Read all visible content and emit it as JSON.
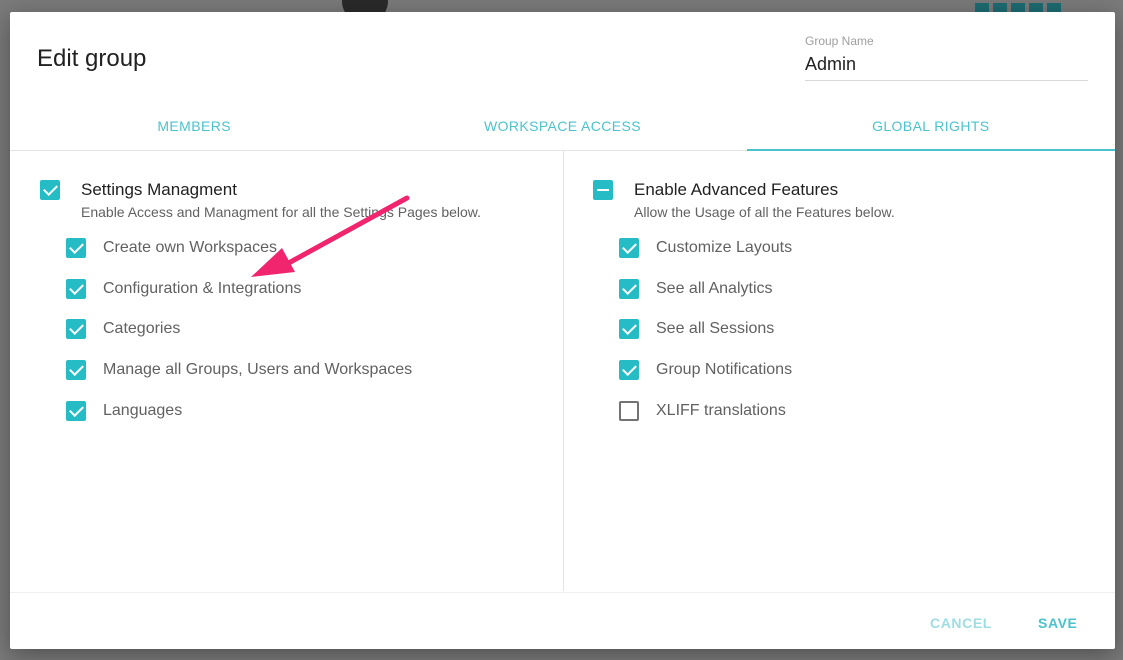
{
  "dialog": {
    "title": "Edit group",
    "group_name_label": "Group Name",
    "group_name_value": "Admin"
  },
  "tabs": [
    {
      "label": "MEMBERS",
      "active": false
    },
    {
      "label": "WORKSPACE ACCESS",
      "active": false
    },
    {
      "label": "GLOBAL RIGHTS",
      "active": true
    }
  ],
  "left_section": {
    "title": "Settings Managment",
    "description": "Enable Access and Managment for all the Settings Pages below.",
    "state": "checked",
    "items": [
      {
        "label": "Create own Workspaces",
        "checked": true
      },
      {
        "label": "Configuration & Integrations",
        "checked": true
      },
      {
        "label": "Categories",
        "checked": true
      },
      {
        "label": "Manage all Groups, Users and Workspaces",
        "checked": true
      },
      {
        "label": "Languages",
        "checked": true
      }
    ]
  },
  "right_section": {
    "title": "Enable Advanced Features",
    "description": "Allow the Usage of all the Features below.",
    "state": "indeterminate",
    "items": [
      {
        "label": "Customize Layouts",
        "checked": true
      },
      {
        "label": "See all Analytics",
        "checked": true
      },
      {
        "label": "See all Sessions",
        "checked": true
      },
      {
        "label": "Group Notifications",
        "checked": true
      },
      {
        "label": "XLIFF translations",
        "checked": false
      }
    ]
  },
  "footer": {
    "cancel_label": "CANCEL",
    "save_label": "SAVE"
  },
  "colors": {
    "accent": "#26bcc6",
    "tab_text": "#4bc3cc",
    "annotation_arrow": "#f0256e"
  },
  "annotation": {
    "icon": "arrow-annotation-icon"
  }
}
